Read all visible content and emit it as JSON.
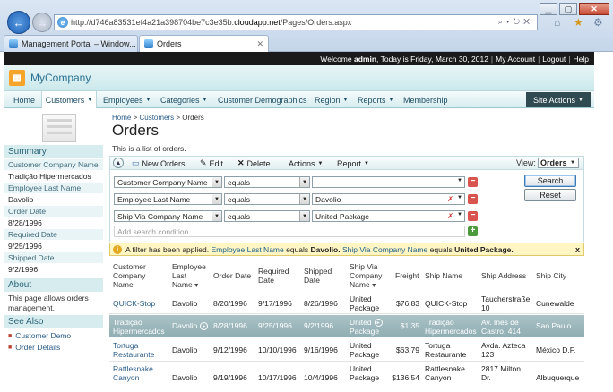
{
  "browser": {
    "url_prefix": "http://d746a83531ef4a21a398704be7c3e35b.",
    "url_host": "cloudapp.net",
    "url_path": "/Pages/Orders.aspx",
    "tabs": [
      {
        "label": "Management Portal – Window..."
      },
      {
        "label": "Orders"
      }
    ]
  },
  "header": {
    "welcome_prefix": "Welcome",
    "user": "admin",
    "today": ", Today is Friday, March 30, 2012",
    "my_account": "My Account",
    "logout": "Logout",
    "help": "Help"
  },
  "brand": {
    "name": "MyCompany"
  },
  "menu": {
    "items": [
      {
        "label": "Home"
      },
      {
        "label": "Customers"
      },
      {
        "label": "Employees"
      },
      {
        "label": "Categories"
      },
      {
        "label": "Customer Demographics"
      },
      {
        "label": "Region"
      },
      {
        "label": "Reports"
      },
      {
        "label": "Membership"
      }
    ],
    "site_actions": "Site Actions"
  },
  "sidebar": {
    "summary_title": "Summary",
    "fields": [
      {
        "label": "Customer Company Name",
        "value": "Tradição Hipermercados"
      },
      {
        "label": "Employee Last Name",
        "value": "Davolio"
      },
      {
        "label": "Order Date",
        "value": "8/28/1996"
      },
      {
        "label": "Required Date",
        "value": "9/25/1996"
      },
      {
        "label": "Shipped Date",
        "value": "9/2/1996"
      }
    ],
    "about_title": "About",
    "about_text": "This page allows orders management.",
    "see_also_title": "See Also",
    "links": [
      {
        "label": "Customer Demo"
      },
      {
        "label": "Order Details"
      }
    ]
  },
  "breadcrumb": {
    "home": "Home",
    "customers": "Customers",
    "current": "Orders"
  },
  "page": {
    "title": "Orders",
    "description": "This is a list of orders."
  },
  "actions": {
    "new": "New Orders",
    "edit": "Edit",
    "delete": "Delete",
    "actions": "Actions",
    "report": "Report",
    "view_label": "View:",
    "view_value": "Orders"
  },
  "filter": {
    "conditions": [
      {
        "field": "Customer Company Name",
        "op": "equals",
        "value": ""
      },
      {
        "field": "Employee Last Name",
        "op": "equals",
        "value": "Davolio"
      },
      {
        "field": "Ship Via Company Name",
        "op": "equals",
        "value": "United Package"
      }
    ],
    "add_placeholder": "Add search condition",
    "search": "Search",
    "reset": "Reset"
  },
  "filter_info": {
    "prefix": "A filter has been applied.",
    "f1": "Employee Last Name",
    "eq1": "equals",
    "v1": "Davolio.",
    "f2": "Ship Via Company Name",
    "eq2": "equals",
    "v2": "United Package."
  },
  "grid": {
    "headers": {
      "customer": [
        "Customer",
        "Company",
        "Name"
      ],
      "employee": [
        "Employee",
        "Last",
        "Name"
      ],
      "order_date": "Order Date",
      "required": [
        "Required",
        "Date"
      ],
      "shipped": [
        "Shipped",
        "Date"
      ],
      "ship_via": [
        "Ship Via",
        "Company",
        "Name"
      ],
      "freight": "Freight",
      "ship_name": "Ship Name",
      "ship_address": "Ship Address",
      "ship_city": "Ship City"
    },
    "rows": [
      {
        "customer": [
          "QUICK-Stop"
        ],
        "employee": "Davolio",
        "order_date": "8/20/1996",
        "required": "9/17/1996",
        "shipped": "8/26/1996",
        "ship_via": [
          "United",
          "Package"
        ],
        "freight": "$76.83",
        "ship_name": [
          "QUICK-Stop"
        ],
        "ship_address": [
          "Taucherstraße",
          "10"
        ],
        "ship_city": "Cunewalde"
      },
      {
        "customer": [
          "Tradição",
          "Hipermercados"
        ],
        "employee": "Davolio",
        "order_date": "8/28/1996",
        "required": "9/25/1996",
        "shipped": "9/2/1996",
        "ship_via": [
          "United",
          "Package"
        ],
        "freight": "$1.35",
        "ship_name": [
          "Tradiçao",
          "Hipermercados"
        ],
        "ship_address": [
          "Av. Inês de",
          "Castro, 414"
        ],
        "ship_city": "Sao Paulo"
      },
      {
        "customer": [
          "Tortuga",
          "Restaurante"
        ],
        "employee": "Davolio",
        "order_date": "9/12/1996",
        "required": "10/10/1996",
        "shipped": "9/16/1996",
        "ship_via": [
          "United",
          "Package"
        ],
        "freight": "$63.79",
        "ship_name": [
          "Tortuga",
          "Restaurante"
        ],
        "ship_address": [
          "Avda. Azteca",
          "123"
        ],
        "ship_city": "México D.F."
      },
      {
        "customer": [
          "Rattlesnake",
          "Canyon"
        ],
        "employee": "Davolio",
        "order_date": "9/19/1996",
        "required": "10/17/1996",
        "shipped": "10/4/1996",
        "ship_via": [
          "United",
          "Package"
        ],
        "freight": "$136.54",
        "ship_name": [
          "Rattlesnake",
          "Canyon"
        ],
        "ship_address": [
          "2817 Milton",
          "Dr."
        ],
        "ship_city": "Albuquerque"
      }
    ]
  }
}
